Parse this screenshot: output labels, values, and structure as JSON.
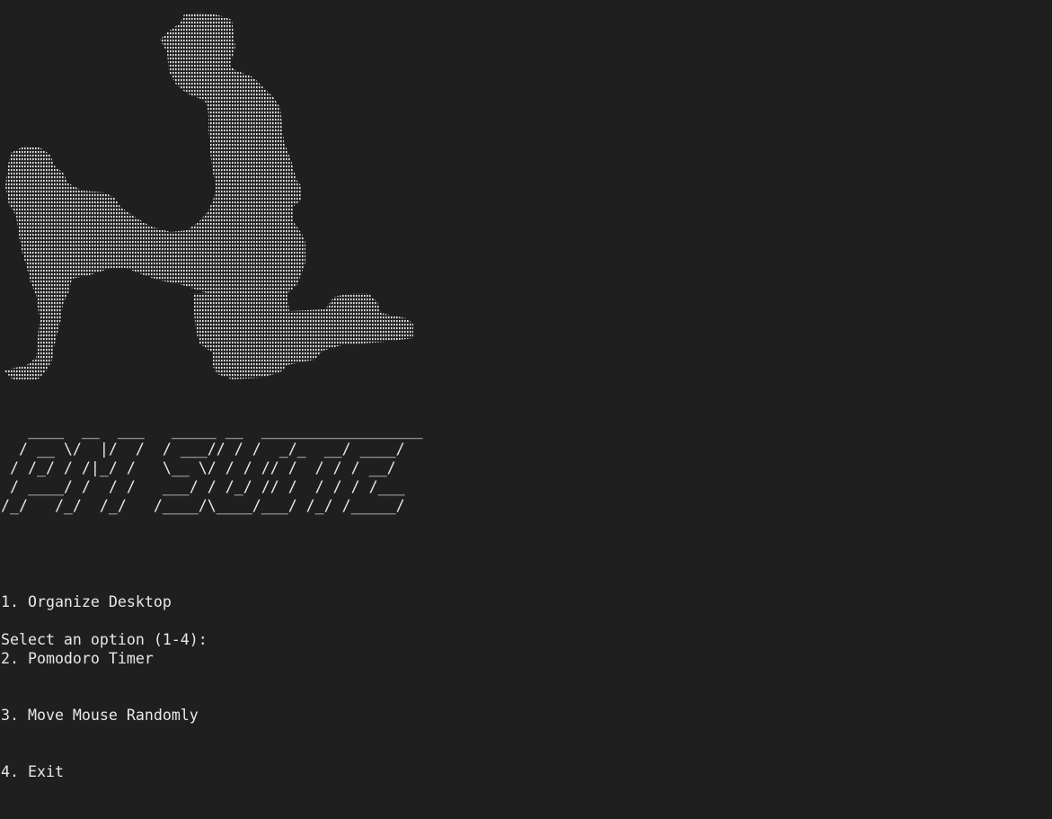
{
  "terminal": {
    "background": "#1f1f1f",
    "foreground": "#e8e8e8",
    "logo_lines": [
      "   ____  __  ___   _____ __  __________________",
      "  / __ \\/  |/  /  / ___// / /  _/_  __/ ____/",
      " / /_/ / /|_/ /   \\__ \\/ / / // /  / / / __/",
      " / ____/ /  / /   ___/ / /_/ // /  / / / /___",
      "/_/   /_/  /_/   /____/\\____/___/ /_/ /_____/"
    ],
    "menu": [
      "1. Organize Desktop",
      "2. Pomodoro Timer",
      "3. Move Mouse Randomly",
      "4. Exit"
    ],
    "prompt": "Select an option (1-4): "
  }
}
